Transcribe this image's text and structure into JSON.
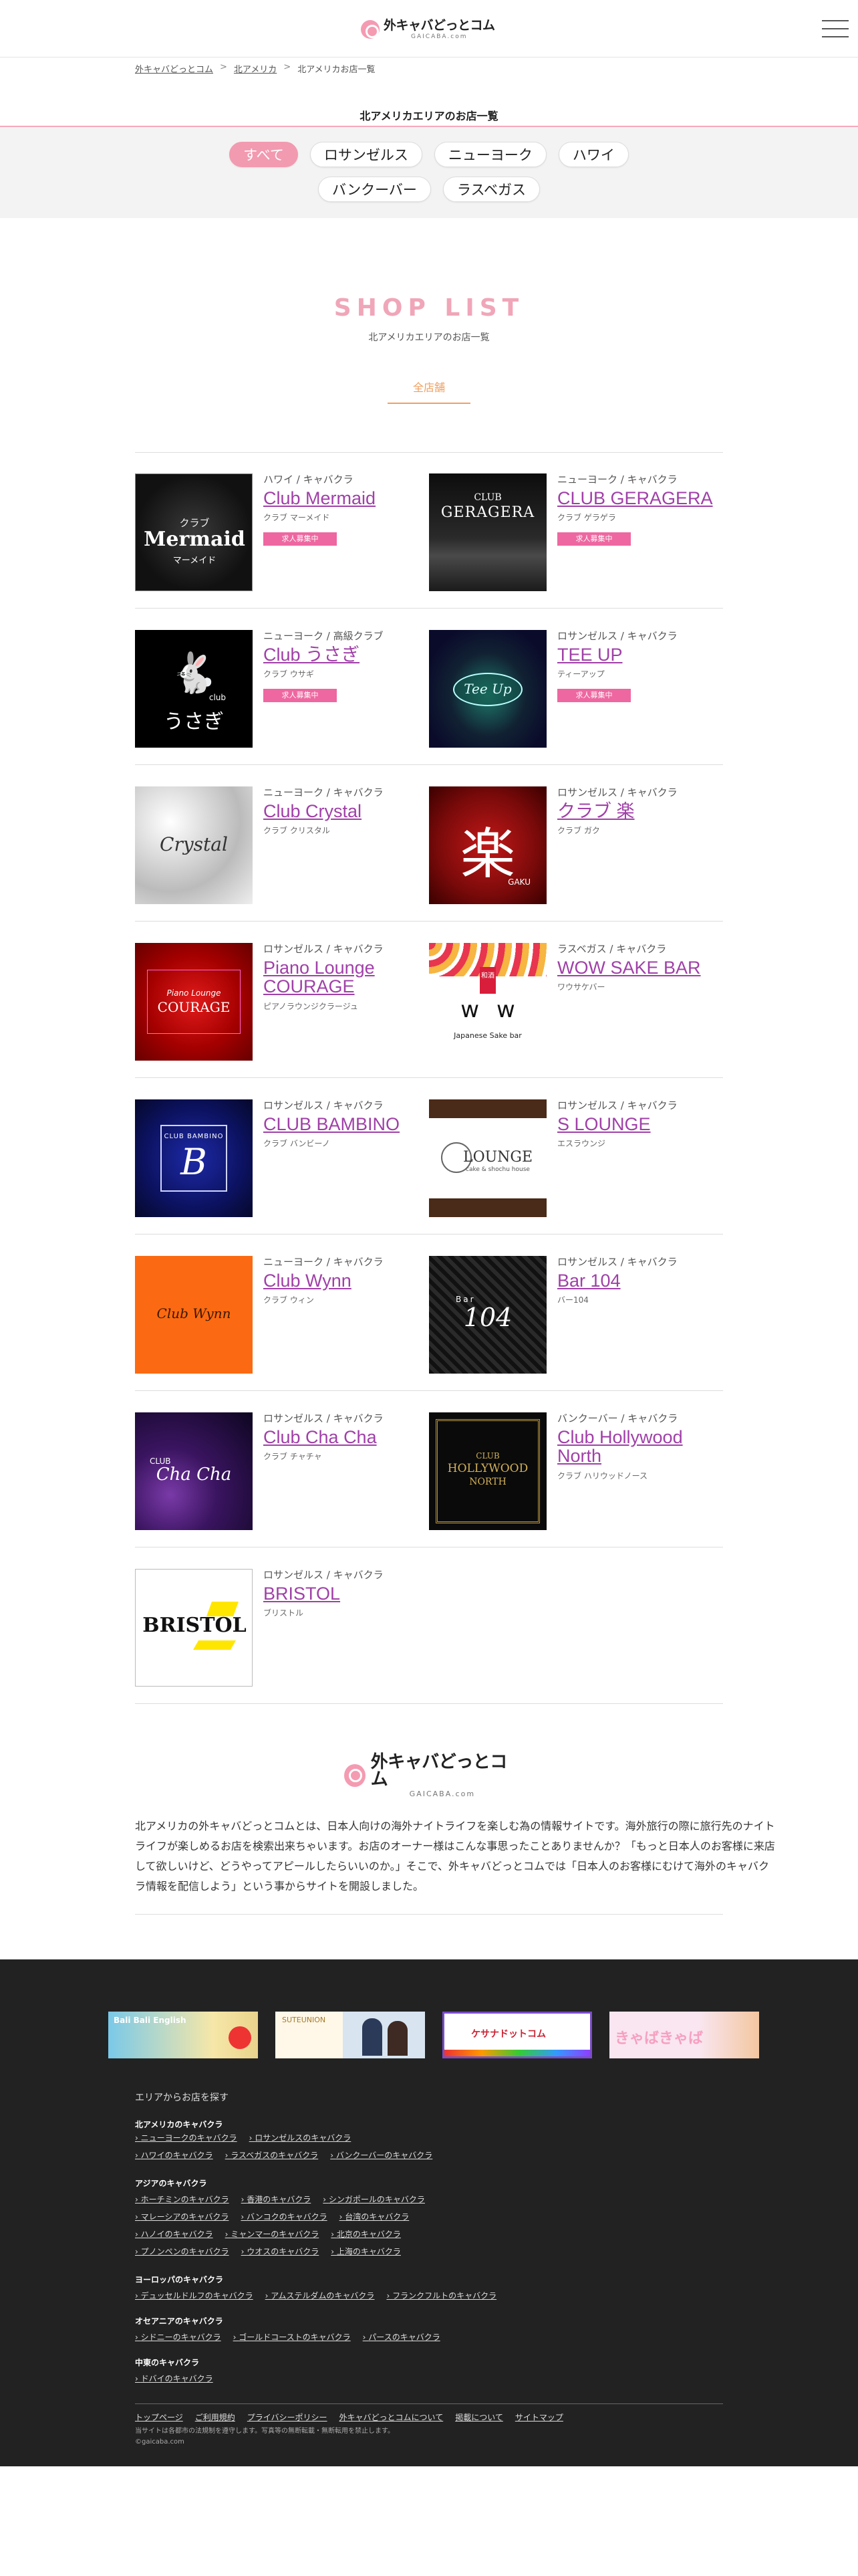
{
  "header": {
    "logo_title": "外キャバどっとコム",
    "logo_sub": "GAICABA.com"
  },
  "breadcrumb": [
    "外キャバどっとコム",
    "北アメリカ",
    "北アメリカお店一覧"
  ],
  "page_title": "北アメリカエリアのお店一覧",
  "filters": {
    "row1": [
      "すべて",
      "ロサンゼルス",
      "ニューヨーク",
      "ハワイ"
    ],
    "row2": [
      "バンクーバー",
      "ラスベガス"
    ],
    "active": "すべて"
  },
  "shop_list": {
    "heading": "SHOP LIST",
    "sub": "北アメリカエリアのお店一覧",
    "tab": "全店舗"
  },
  "badge_label": "求人募集中",
  "shops": [
    {
      "meta": "ハワイ / キャバクラ",
      "name": "Club Mermaid",
      "kana": "クラブ マーメイド",
      "badge": true,
      "thumb_text": "Mermaid",
      "thumb_top": "クラブ",
      "thumb_bottom": "マーメイド"
    },
    {
      "meta": "ニューヨーク / キャバクラ",
      "name": "CLUB GERAGERA",
      "kana": "クラブ ゲラゲラ",
      "badge": true,
      "thumb_text": "GERAGERA",
      "thumb_top": "CLUB"
    },
    {
      "meta": "ニューヨーク / 高級クラブ",
      "name": "Club うさぎ",
      "kana": "クラブ ウサギ",
      "badge": true,
      "thumb_text": "うさぎ",
      "thumb_top": "club"
    },
    {
      "meta": "ロサンゼルス / キャバクラ",
      "name": "TEE UP",
      "kana": "ティーアップ",
      "badge": true,
      "thumb_text": "Tee Up"
    },
    {
      "meta": "ニューヨーク / キャバクラ",
      "name": "Club Crystal",
      "kana": "クラブ クリスタル",
      "badge": false,
      "thumb_text": "Crystal"
    },
    {
      "meta": "ロサンゼルス / キャバクラ",
      "name": "クラブ 楽",
      "kana": "クラブ ガク",
      "badge": false,
      "thumb_text": "楽",
      "thumb_bottom": "GAKU"
    },
    {
      "meta": "ロサンゼルス / キャバクラ",
      "name": "Piano Lounge COURAGE",
      "kana": "ピアノラウンジクラージュ",
      "badge": false,
      "thumb_text": "COURAGE",
      "thumb_top": "Piano Lounge"
    },
    {
      "meta": "ラスベガス / キャバクラ",
      "name": "WOW SAKE BAR",
      "kana": "ワウサケバー",
      "badge": false,
      "thumb_text": "Japanese Sake bar",
      "thumb_top": "和酒"
    },
    {
      "meta": "ロサンゼルス / キャバクラ",
      "name": "CLUB BAMBINO",
      "kana": "クラブ バンビーノ",
      "badge": false,
      "thumb_text": "B",
      "thumb_top": "CLUB BAMBINO"
    },
    {
      "meta": "ロサンゼルス / キャバクラ",
      "name": "S LOUNGE",
      "kana": "エスラウンジ",
      "badge": false,
      "thumb_text": "LOUNGE",
      "thumb_bottom": "cake & shochu house"
    },
    {
      "meta": "ニューヨーク / キャバクラ",
      "name": "Club Wynn",
      "kana": "クラブ ウィン",
      "badge": false,
      "thumb_text": "Club Wynn"
    },
    {
      "meta": "ロサンゼルス / キャバクラ",
      "name": "Bar 104",
      "kana": "バー104",
      "badge": false,
      "thumb_text": "104",
      "thumb_top": "Bar"
    },
    {
      "meta": "ロサンゼルス / キャバクラ",
      "name": "Club Cha Cha",
      "kana": "クラブ チャチャ",
      "badge": false,
      "thumb_text": "Cha Cha",
      "thumb_top": "CLUB"
    },
    {
      "meta": "バンクーバー / キャバクラ",
      "name": "Club Hollywood North",
      "kana": "クラブ ハリウッドノース",
      "badge": false,
      "thumb_text": "HOLLYWOOD",
      "thumb_top": "CLUB",
      "thumb_bottom": "NORTH"
    },
    {
      "meta": "ロサンゼルス / キャバクラ",
      "name": "BRISTOL",
      "kana": "ブリストル",
      "badge": false,
      "thumb_text": "BRISTOL"
    }
  ],
  "about": {
    "logo_title": "外キャバどっとコム",
    "logo_sub": "GAICABA.com",
    "text": "北アメリカの外キャバどっとコムとは、日本人向けの海外ナイトライフを楽しむ為の情報サイトです。海外旅行の際に旅行先のナイトライフが楽しめるお店を検索出来ちゃいます。お店のオーナー様はこんな事思ったことありませんか？「もっと日本人のお客様に来店して欲しいけど、どうやってアピールしたらいいのか。」そこで、外キャバどっとコムでは「日本人のお客様にむけて海外のキャバクラ情報を配信しよう」という事からサイトを開設しました。"
  },
  "footer": {
    "banners": [
      "Bali Bali English",
      "SUTEUNION",
      "ケサナドットコム",
      "きゃばきゃば"
    ],
    "heading": "エリアからお店を探す",
    "regions": [
      {
        "name": "北アメリカのキャバクラ",
        "rows": [
          [
            "ニューヨークのキャバクラ",
            "ロサンゼルスのキャバクラ"
          ],
          [
            "ハワイのキャバクラ",
            "ラスベガスのキャバクラ",
            "バンクーバーのキャバクラ"
          ]
        ]
      },
      {
        "name": "アジアのキャバクラ",
        "rows": [
          [
            "ホーチミンのキャバクラ",
            "香港のキャバクラ",
            "シンガポールのキャバクラ"
          ],
          [
            "マレーシアのキャバクラ",
            "バンコクのキャバクラ",
            "台湾のキャバクラ"
          ],
          [
            "ハノイのキャバクラ",
            "ミャンマーのキャバクラ",
            "北京のキャバクラ"
          ],
          [
            "プノンペンのキャバクラ",
            "ウオスのキャバクラ",
            "上海のキャバクラ"
          ]
        ]
      },
      {
        "name": "ヨーロッパのキャバクラ",
        "rows": [
          [
            "デュッセルドルフのキャバクラ",
            "アムステルダムのキャバクラ",
            "フランクフルトのキャバクラ"
          ]
        ]
      },
      {
        "name": "オセアニアのキャバクラ",
        "rows": [
          [
            "シドニーのキャバクラ",
            "ゴールドコーストのキャバクラ",
            "パースのキャバクラ"
          ]
        ]
      },
      {
        "name": "中東のキャバクラ",
        "rows": [
          [
            "ドバイのキャバクラ"
          ]
        ]
      }
    ],
    "bottom_links": [
      "トップページ",
      "ご利用規約",
      "プライバシーポリシー",
      "外キャバどっとコムについて",
      "掲載について",
      "サイトマップ"
    ],
    "note": "当サイトは各都市の法規制を遵守します。写真等の無断転載・無断転用を禁止します。",
    "copyright": "©gaicaba.com"
  }
}
